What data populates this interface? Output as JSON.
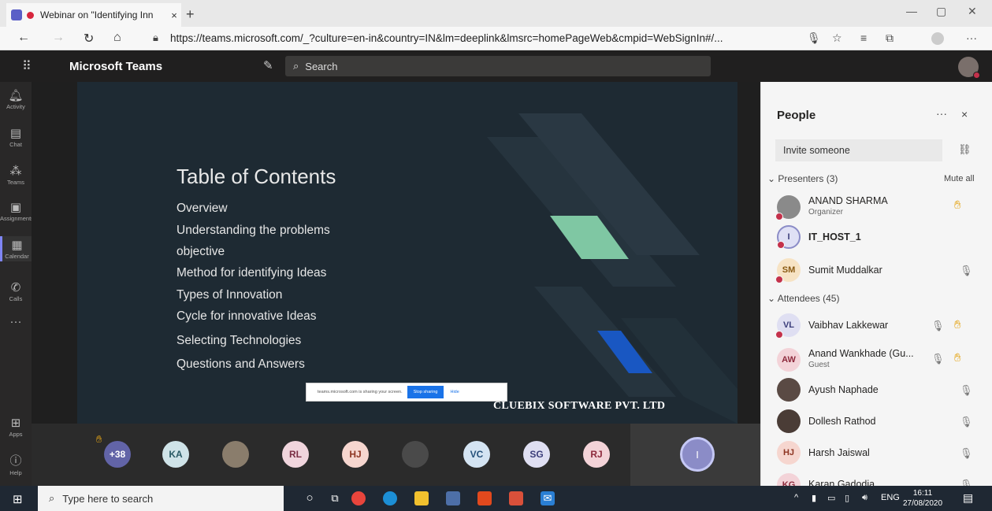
{
  "browser": {
    "tab_title": "Webinar on \"Identifying Inn",
    "tab_close": "×",
    "new_tab": "+",
    "url": "https://teams.microsoft.com/_?culture=en-in&country=IN&lm=deeplink&lmsrc=homePageWeb&cmpid=WebSignIn#/...",
    "win_min": "—",
    "win_max": "▢",
    "win_close": "✕"
  },
  "teams": {
    "title": "Microsoft Teams",
    "search_placeholder": "Search"
  },
  "rail": [
    {
      "label": "Activity",
      "icon": "bell-icon"
    },
    {
      "label": "Chat",
      "icon": "chat-icon"
    },
    {
      "label": "Teams",
      "icon": "teams-icon"
    },
    {
      "label": "Assignments",
      "icon": "assignments-icon"
    },
    {
      "label": "Calendar",
      "icon": "calendar-icon"
    },
    {
      "label": "Calls",
      "icon": "phone-icon"
    },
    {
      "label": "Apps",
      "icon": "apps-icon"
    },
    {
      "label": "Help",
      "icon": "help-icon"
    }
  ],
  "slide": {
    "heading": "Table of Contents",
    "items": [
      "Overview",
      "Understanding the problems",
      "objective",
      "Method for identifying Ideas",
      "Types of Innovation",
      "Cycle for innovative Ideas",
      "Selecting Technologies",
      "Questions and Answers"
    ],
    "watermark": "CLUEBIX SOFTWARE PVT. LTD",
    "share_text": "teams.microsoft.com is sharing your screen.",
    "stop_sharing": "Stop sharing",
    "hide": "Hide"
  },
  "strip": {
    "overflow": "+38",
    "avatars": [
      "KA",
      "RL",
      "HJ",
      "VC",
      "SG",
      "RJ"
    ],
    "you": "I"
  },
  "people": {
    "title": "People",
    "more": "···",
    "close": "×",
    "invite_placeholder": "Invite someone",
    "presenters_header": "Presenters (3)",
    "mute_all": "Mute all",
    "attendees_header": "Attendees (45)",
    "presenters": [
      {
        "initials": "",
        "name": "ANAND SHARMA",
        "sub": "Organizer"
      },
      {
        "initials": "I",
        "name": "IT_HOST_1",
        "sub": ""
      },
      {
        "initials": "SM",
        "name": "Sumit Muddalkar",
        "sub": ""
      }
    ],
    "attendees": [
      {
        "initials": "VL",
        "name": "Vaibhav Lakkewar",
        "sub": ""
      },
      {
        "initials": "AW",
        "name": "Anand Wankhade (Gu...",
        "sub": "Guest"
      },
      {
        "initials": "",
        "name": "Ayush Naphade",
        "sub": ""
      },
      {
        "initials": "",
        "name": "Dollesh Rathod",
        "sub": ""
      },
      {
        "initials": "HJ",
        "name": "Harsh Jaiswal",
        "sub": ""
      },
      {
        "initials": "KG",
        "name": "Karan Gadodia",
        "sub": ""
      }
    ]
  },
  "taskbar": {
    "search_placeholder": "Type here to search",
    "lang": "ENG",
    "time": "16:11",
    "date": "27/08/2020"
  },
  "colors": {
    "teams_header": "#201f1f",
    "rail": "#292828",
    "accent": "#7f85f5",
    "presence_busy": "#c4314b",
    "hand": "#e5a516",
    "slide_bg": "#1e2a33",
    "taskbar": "#1f2833"
  }
}
